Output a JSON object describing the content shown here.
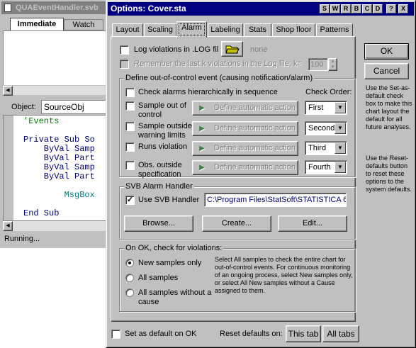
{
  "bg_window": {
    "title": "QUAEventHandler.svb",
    "tabs": [
      "Immediate",
      "Watch"
    ],
    "object_label": "Object:",
    "object_value": "SourceObj",
    "code_lines": [
      "'Events",
      "",
      "Private Sub So",
      "    ByVal Samp",
      "    ByVal Part",
      "    ByVal Samp",
      "    ByVal Part",
      "",
      "        MsgBox",
      "",
      "End Sub"
    ],
    "status": "Running..."
  },
  "dialog": {
    "title": "Options: Cover.sta",
    "title_buttons": [
      "S",
      "W",
      "R",
      "B",
      "C",
      "D",
      "?",
      "X"
    ],
    "tabs": [
      "Layout",
      "Scaling",
      "Alarm",
      "Labeling",
      "Stats",
      "Shop floor",
      "Patterns"
    ],
    "log": {
      "label": "Log violations in .LOG fil",
      "value": "none"
    },
    "remember": {
      "label": "Remember the last k violations in the Log file; k=",
      "value": "100"
    },
    "define_group": {
      "title": "Define out-of-control event (causing notification/alarm)",
      "hierarchical_label": "Check alarms hierarchically in sequence",
      "check_order_label": "Check Order:",
      "action_label": "Define automatic action",
      "rows": [
        {
          "label1": "Sample out of",
          "label2": "control",
          "order": "First"
        },
        {
          "label1": "Sample outside",
          "label2": "warning limits",
          "order": "Second"
        },
        {
          "label1": "Runs violation",
          "label2": "",
          "order": "Third"
        },
        {
          "label1": "Obs. outside",
          "label2": "specification",
          "order": "Fourth"
        }
      ]
    },
    "svb_group": {
      "title": "SVB Alarm Handler",
      "use_label": "Use SVB Handler",
      "path": "C:\\Program Files\\StatSoft\\STATISTICA 6",
      "browse": "Browse...",
      "create": "Create...",
      "edit": "Edit..."
    },
    "onok_group": {
      "title": "On OK, check for violations:",
      "options": [
        "New samples only",
        "All samples",
        "All samples without a",
        "cause"
      ],
      "description": "Select All samples to check the entire chart for out-of-control events. For continuous monitoring of an ongoing process, select New samples only, or select All New samples without a Cause assigned to them."
    },
    "ok": "OK",
    "cancel": "Cancel",
    "help1": "Use the Set-as-default check box to make this chart layout the default for all future analyses.",
    "help2": "Use the Reset-defaults button to reset these options to the system defaults.",
    "set_default": "Set as default on OK",
    "reset_label": "Reset defaults on:",
    "this_tab": "This tab",
    "all_tabs": "All tabs"
  },
  "colors": {
    "title_active": "#000080",
    "face": "#c0c0c0",
    "path_text": "#000080"
  }
}
